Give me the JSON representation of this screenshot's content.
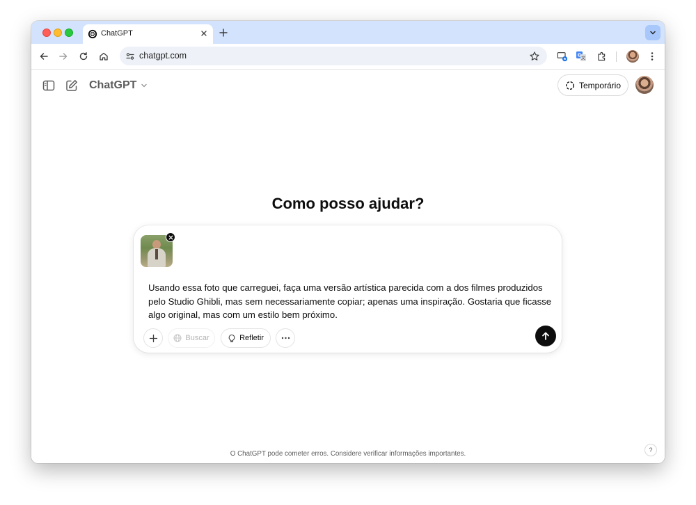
{
  "browser": {
    "tab": {
      "title": "ChatGPT",
      "favicon": "openai-icon"
    },
    "address": {
      "url": "chatgpt.com"
    },
    "colors": {
      "tab_strip": "#d3e3fd",
      "omnibox": "#eef2f8"
    }
  },
  "app": {
    "brand": "ChatGPT",
    "temporary_label": "Temporário",
    "headline": "Como posso ajudar?",
    "composer": {
      "text": "Usando essa foto que carreguei, faça uma versão artística parecida com a dos filmes produzidos pelo Studio Ghibli, mas sem necessariamente copiar; apenas uma inspiração. Gostaria que ficasse algo original, mas com um estilo bem próximo.",
      "buttons": {
        "search": "Buscar",
        "reason": "Refletir"
      }
    },
    "footer": "O ChatGPT pode cometer erros. Considere verificar informações importantes.",
    "help": "?"
  }
}
